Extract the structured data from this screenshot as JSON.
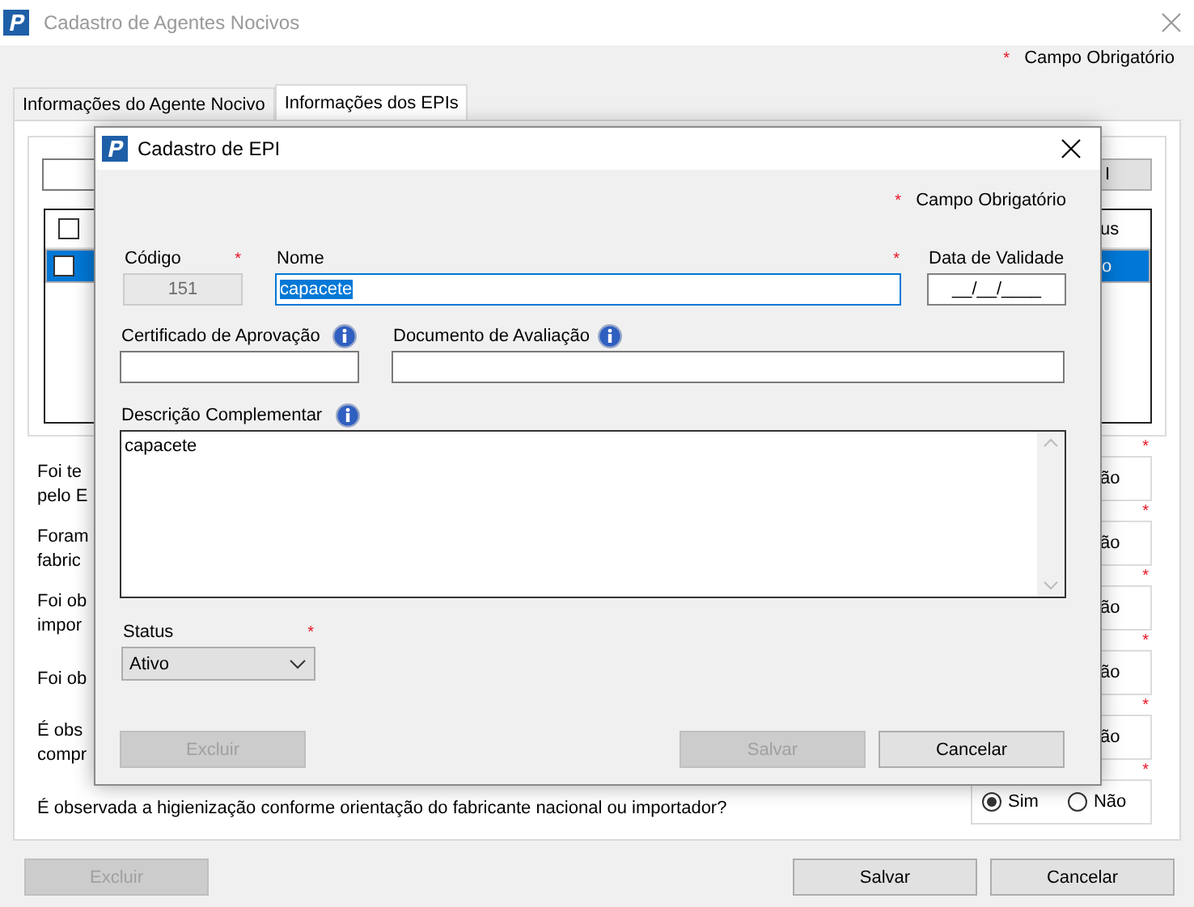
{
  "window": {
    "title": "Cadastro de Agentes Nocivos",
    "legend": {
      "mark": "*",
      "text": "Campo Obrigatório"
    }
  },
  "tabs": [
    {
      "label": "Informações do Agente Nocivo",
      "selected": false
    },
    {
      "label": "Informações dos EPIs",
      "selected": true
    }
  ],
  "epi_toolbar": {
    "button": "I"
  },
  "epi_grid": {
    "header": {
      "checked": false,
      "column_2": "us"
    },
    "rows": [
      {
        "checked": false,
        "column_2": "o",
        "selected": true
      }
    ]
  },
  "questions": [
    {
      "lines": [
        "Foi te",
        "pelo E"
      ],
      "mark": "*",
      "option_fragment": "ão"
    },
    {
      "lines": [
        "Foram",
        "fabric"
      ],
      "mark": "*",
      "option_fragment": "ão"
    },
    {
      "lines": [
        "Foi ob",
        "impor"
      ],
      "mark": "*",
      "option_fragment": "ão"
    },
    {
      "lines": [
        "Foi ob"
      ],
      "mark": "*",
      "option_fragment": "ão"
    },
    {
      "lines": [
        "É obs",
        "compr"
      ],
      "mark": "*",
      "option_fragment": "ão"
    },
    {
      "lines": [
        "É observada a higienização conforme orientação do fabricante nacional ou importador?"
      ],
      "mark": "*",
      "options": [
        {
          "label": "Sim",
          "selected": true
        },
        {
          "label": "Não",
          "selected": false
        }
      ]
    }
  ],
  "buttons": [
    {
      "label": "Excluir",
      "disabled": true
    },
    {
      "label": "Salvar",
      "disabled": false
    },
    {
      "label": "Cancelar",
      "disabled": false
    }
  ],
  "dialog": {
    "title": "Cadastro de EPI",
    "legend": {
      "mark": "*",
      "text": "Campo Obrigatório"
    },
    "codigo": {
      "label": "Código",
      "mark": "*",
      "value": "151",
      "disabled": true
    },
    "nome": {
      "label": "Nome",
      "mark": "*",
      "value": "capacete",
      "text_selected": true
    },
    "data_validade": {
      "label": "Data de Validade",
      "value": "__/__/____"
    },
    "certificado": {
      "label": "Certificado de Aprovação"
    },
    "documento": {
      "label": "Documento de Avaliação"
    },
    "descricao": {
      "label": "Descrição Complementar",
      "value": "capacete"
    },
    "status": {
      "label": "Status",
      "mark": "*",
      "value": "Ativo"
    },
    "buttons": [
      {
        "label": "Excluir",
        "disabled": true
      },
      {
        "label": "Salvar",
        "disabled": true
      },
      {
        "label": "Cancelar",
        "disabled": false
      }
    ]
  }
}
